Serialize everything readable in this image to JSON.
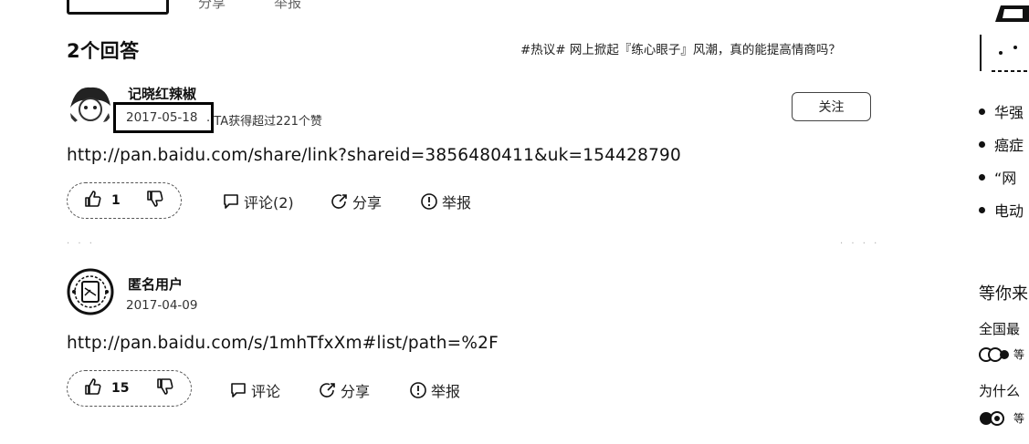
{
  "top_bar": {
    "share_label": "分享",
    "report_label": "举报"
  },
  "answers_header": {
    "title": "2个回答",
    "hot_topic": "#热议# 网上掀起『练心眼子』风潮，真的能提高情商吗？"
  },
  "answers": [
    {
      "username": "记晓红辣椒",
      "date": "2017-05-18",
      "meta_extra": "· TA获得超过221个赞",
      "follow_label": "关注",
      "content": "http://pan.baidu.com/share/link?shareid=3856480411&uk=154428790",
      "like_count": "1",
      "comment_label": "评论(2)",
      "share_label": "分享",
      "report_label": "举报"
    },
    {
      "username": "匿名用户",
      "date": "2017-04-09",
      "content": "http://pan.baidu.com/s/1mhTfxXm#list/path=%2F",
      "like_count": "15",
      "comment_label": "评论",
      "share_label": "分享",
      "report_label": "举报"
    }
  ],
  "sidebar": {
    "list": [
      {
        "label": "华强"
      },
      {
        "label": "癌症"
      },
      {
        "label": "“网"
      },
      {
        "label": "电动"
      }
    ],
    "heading": "等你来",
    "questions": [
      {
        "title": "全国最",
        "meta": "等"
      },
      {
        "title": "为什么",
        "meta": "等"
      }
    ]
  }
}
